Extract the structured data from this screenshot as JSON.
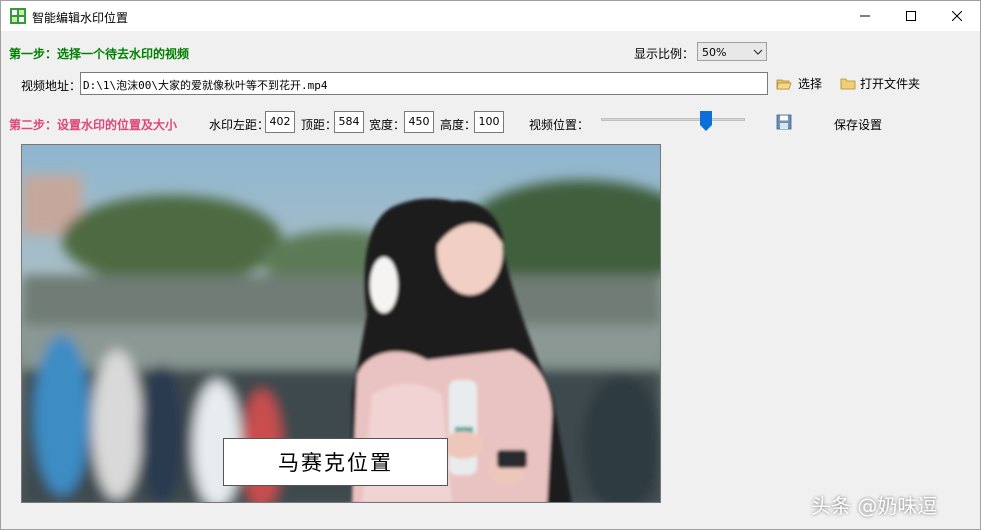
{
  "window": {
    "title": "智能编辑水印位置"
  },
  "step1": {
    "label": "第一步：选择一个待去水印的视频",
    "zoom_label": "显示比例：",
    "zoom_value": "50%",
    "path_label": "视频地址：",
    "path_value": "D:\\1\\泡沫00\\大家的爱就像秋叶等不到花开.mp4",
    "select_label": "选择",
    "open_folder_label": "打开文件夹"
  },
  "step2": {
    "label": "第二步：设置水印的位置及大小",
    "left_label": "水印左距：",
    "left_value": "402",
    "top_label": "顶距：",
    "top_value": "584",
    "width_label": "宽度：",
    "width_value": "450",
    "height_label": "高度：",
    "height_value": "100",
    "video_pos_label": "视频位置：",
    "video_pos_value": 0.73,
    "save_label": "保存设置"
  },
  "preview": {
    "mosaic_label": "马赛克位置"
  },
  "watermark": {
    "text": "头条 @奶味逗"
  },
  "colors": {
    "step1": "#008000",
    "step2": "#e0457b",
    "slider_thumb": "#0a6fd8"
  }
}
